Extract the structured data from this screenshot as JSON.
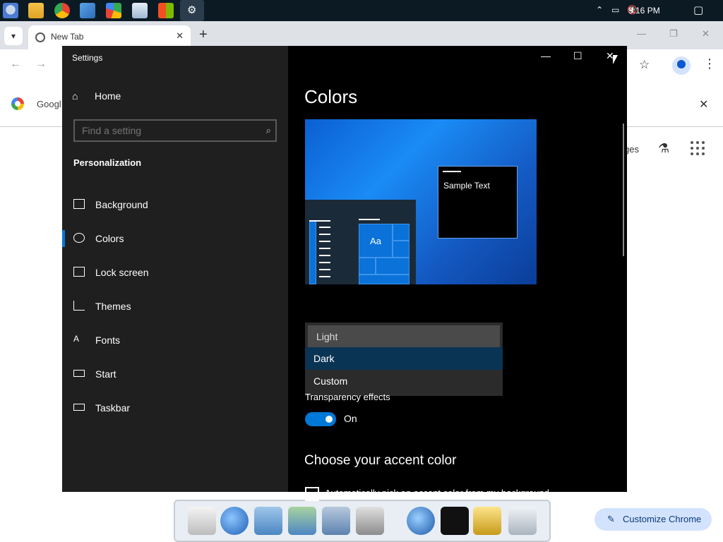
{
  "taskbar": {
    "icons": [
      "finder-icon",
      "file-explorer-icon",
      "chrome-icon",
      "photos-icon",
      "play-store-icon",
      "network-icon",
      "windows-logo-icon",
      "settings-icon"
    ],
    "clock": "9:16 PM",
    "colors": {
      "bar": "#0c1a24"
    }
  },
  "browser": {
    "tab_title": "New Tab",
    "info_text": "Googl",
    "ntp_link": "ges",
    "customize_label": "Customize Chrome"
  },
  "settings": {
    "app_title": "Settings",
    "home_label": "Home",
    "search": {
      "placeholder": "Find a setting"
    },
    "section_title": "Personalization",
    "nav": [
      {
        "label": "Background",
        "icon": "image-icon"
      },
      {
        "label": "Colors",
        "icon": "palette-icon"
      },
      {
        "label": "Lock screen",
        "icon": "monitor-icon"
      },
      {
        "label": "Themes",
        "icon": "brush-icon"
      },
      {
        "label": "Fonts",
        "icon": "fonts-icon"
      },
      {
        "label": "Start",
        "icon": "start-icon"
      },
      {
        "label": "Taskbar",
        "icon": "taskbar-icon"
      }
    ],
    "selected_nav": "Colors",
    "page_title": "Colors",
    "preview": {
      "sample_text": "Sample Text",
      "tile_label": "Aa"
    },
    "mode_options": [
      "Light",
      "Dark",
      "Custom"
    ],
    "mode_selected": "Dark",
    "transparency_label": "Transparency effects",
    "transparency_state": "On",
    "accent_title": "Choose your accent color",
    "auto_accent_label": "Automatically pick an accent color from my background",
    "accent_color": "#0078d7"
  }
}
